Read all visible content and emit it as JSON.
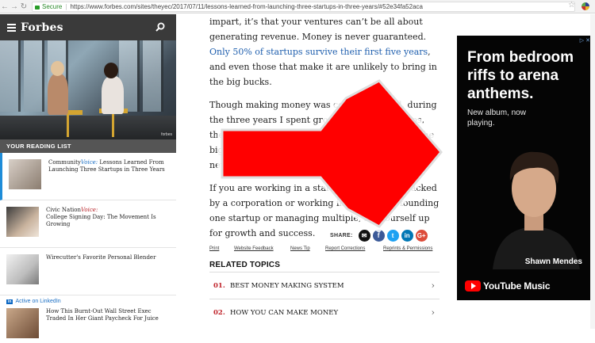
{
  "browser": {
    "secure_label": "Secure",
    "url": "https://www.forbes.com/sites/theyec/2017/07/11/lessons-learned-from-launching-three-startups-in-three-years/#52e34fa52aca"
  },
  "header": {
    "logo": "Forbes"
  },
  "reading_list": {
    "title": "YOUR READING LIST",
    "items": [
      {
        "prefix": "Community",
        "voice": "Voice:",
        "title": " Lessons Learned From Launching Three Startups in Three Years"
      },
      {
        "prefix": "Civic Nation",
        "voice": "Voice:",
        "title": "College Signing Day: The Movement Is Growing"
      },
      {
        "title": "Wirecutter's Favorite Personal Blender"
      },
      {
        "badge": "in",
        "label": "Active on LinkedIn",
        "title": "How This Burnt-Out Wall Street Exec Traded In Her Giant Paycheck For Juice"
      }
    ]
  },
  "article": {
    "p1_a": "impart, it’s that your ventures can’t be all about generating revenue. Money is never guaranteed. ",
    "p1_link": "Only 50% of startups survive their first five years",
    "p1_b": ", and even those that make it are unlikely to bring in the big bucks.",
    "p2": "Though making money was certainly a goal, during the three years I spent growth hacking startups, the real rewards were the relationships I built, the biggest gains the insights I learned, and my network of like people. These m",
    "p3": "If you are working in a startup and you're a backed by a corporation or working in a company, founding one startup or managing multiple, set yourself up for growth and success."
  },
  "share": {
    "label": "SHARE:"
  },
  "tools": [
    "Print",
    "Website Feedback",
    "News Tip",
    "Report Corrections",
    "Reprints & Permissions"
  ],
  "related": {
    "title": "RELATED TOPICS",
    "items": [
      {
        "num": "01.",
        "text": "BEST MONEY MAKING SYSTEM"
      },
      {
        "num": "02.",
        "text": "HOW YOU CAN MAKE MONEY"
      }
    ]
  },
  "ad": {
    "headline": "From bedroom riffs to arena anthems.",
    "sub": "New album, now playing.",
    "artist": "Shawn Mendes",
    "brand": "YouTube Music"
  },
  "colors": {
    "accent_red": "#c0262d",
    "link_blue": "#1f5fae",
    "forbes_dark": "#3a3a3a",
    "arrow_red": "#ff0000"
  }
}
